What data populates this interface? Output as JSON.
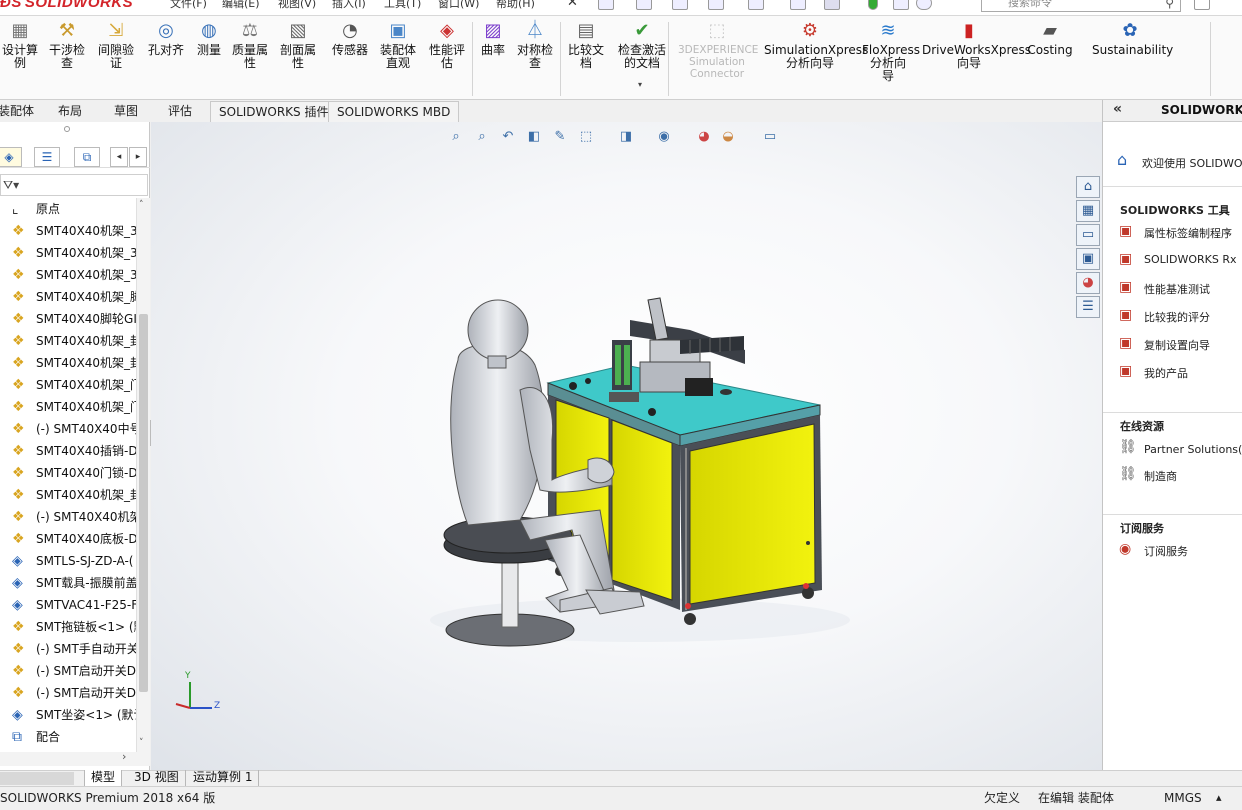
{
  "brand": {
    "logo_text": "SOLIDWORKS"
  },
  "menu": [
    "文件(F)",
    "编辑(E)",
    "视图(V)",
    "插入(I)",
    "工具(T)",
    "窗口(W)",
    "帮助(H)"
  ],
  "search": {
    "placeholder": "搜索命令"
  },
  "command_manager": {
    "tools": [
      {
        "label": "设计算\n例",
        "icon": "design-study-icon"
      },
      {
        "label": "干涉检\n查",
        "icon": "interference-check-icon"
      },
      {
        "label": "间隙验\n证",
        "icon": "clearance-verification-icon"
      },
      {
        "label": "孔对齐",
        "icon": "hole-alignment-icon"
      },
      {
        "label": "测量",
        "icon": "measure-icon"
      },
      {
        "label": "质量属\n性",
        "icon": "mass-properties-icon"
      },
      {
        "label": "剖面属\n性",
        "icon": "section-properties-icon"
      },
      {
        "label": "传感器",
        "icon": "sensor-icon"
      },
      {
        "label": "装配体\n直观",
        "icon": "assemblyxpert-icon"
      },
      {
        "label": "性能评\n估",
        "icon": "performance-evaluation-icon"
      },
      {
        "label": "曲率",
        "icon": "curvature-icon"
      },
      {
        "label": "对称检\n查",
        "icon": "symmetry-check-icon"
      },
      {
        "label": "比较文\n档",
        "icon": "compare-documents-icon"
      },
      {
        "label": "检查激活\n的文档",
        "icon": "check-active-document-icon"
      },
      {
        "label": "3DEXPERIENCE\nSimulation\nConnector",
        "icon": "3dexperience-icon",
        "disabled": true
      },
      {
        "label": "SimulationXpress\n分析向导",
        "icon": "simulationxpress-icon"
      },
      {
        "label": "FloXpress\n分析向\n导",
        "icon": "floxpress-icon"
      },
      {
        "label": "DriveWorksXpress\n向导",
        "icon": "driveworksxpress-icon"
      },
      {
        "label": "Costing",
        "icon": "costing-icon"
      },
      {
        "label": "Sustainability",
        "icon": "sustainability-icon"
      }
    ]
  },
  "tabs": [
    {
      "label": "装配体"
    },
    {
      "label": "布局"
    },
    {
      "label": "草图"
    },
    {
      "label": "评估",
      "active": true
    },
    {
      "label": "SOLIDWORKS 插件"
    },
    {
      "label": "SOLIDWORKS MBD"
    }
  ],
  "tree": {
    "origin_label": "原点",
    "items": [
      "SMT40X40机架_3",
      "SMT40X40机架_3",
      "SMT40X40机架_3",
      "SMT40X40机架_脚",
      "SMT40X40脚轮GI",
      "SMT40X40机架_封",
      "SMT40X40机架_封",
      "SMT40X40机架_门",
      "SMT40X40机架_门",
      "(-) SMT40X40中号",
      "SMT40X40插销-D",
      "SMT40X40门锁-D",
      "SMT40X40机架_封",
      "(-) SMT40X40机架",
      "SMT40X40底板-D",
      "SMTLS-SJ-ZD-A-(",
      "SMT载具-振膜前盖",
      "SMTVAC41-F25-F",
      "SMT拖链板<1> (默",
      "(-) SMT手自动开关",
      "(-) SMT启动开关D",
      "(-) SMT启动开关D",
      "SMT坐姿<1> (默认"
    ],
    "mates_label": "配合"
  },
  "bottom_tabs": [
    {
      "label": "模型",
      "active": true
    },
    {
      "label": "3D 视图"
    },
    {
      "label": "运动算例 1"
    }
  ],
  "status": {
    "product": "SOLIDWORKS Premium 2018 x64 版",
    "definition": "欠定义",
    "editing": "在编辑 装配体",
    "units": "MMGS"
  },
  "task_pane": {
    "title": "SOLIDWORKS",
    "welcome": "欢迎使用  SOLIDWO",
    "tools_header": "SOLIDWORKS 工具",
    "tools": [
      "属性标签编制程序",
      "SOLIDWORKS Rx",
      "性能基准测试",
      "比较我的评分",
      "复制设置向导",
      "我的产品"
    ],
    "online_header": "在线资源",
    "online": [
      "Partner Solutions(解",
      "制造商"
    ],
    "subscription_header": "订阅服务",
    "subscription": [
      "订阅服务"
    ]
  },
  "colors": {
    "table_top": "#3fc9c9",
    "cabinet_panels": "#e8e80a",
    "frame": "#4a4f57",
    "accent_red": "#d3242a",
    "mannequin": "#d9dbe0"
  }
}
